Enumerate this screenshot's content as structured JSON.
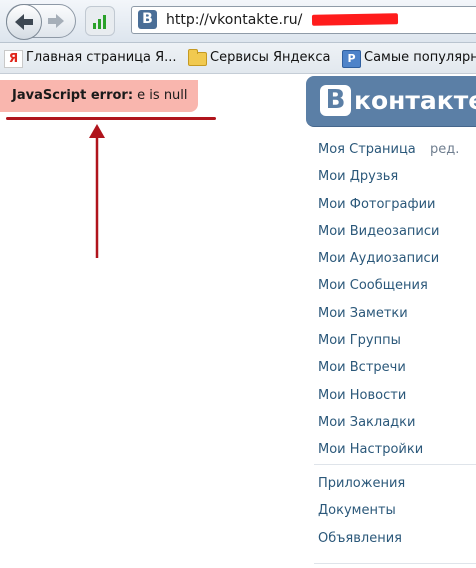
{
  "browser": {
    "url": "http://vkontakte.ru/",
    "bookmarks": [
      {
        "icon": "yandex-icon",
        "label": "Главная страница Я..."
      },
      {
        "icon": "folder-icon",
        "label": "Сервисы Яндекса"
      },
      {
        "icon": "popular-icon",
        "label": "Самые популярн"
      }
    ]
  },
  "error": {
    "prefix": "JavaScript error:",
    "message": "e is null"
  },
  "vk": {
    "logo_letter": "В",
    "logo_text": "контакте",
    "edit_label": "ред.",
    "menu": [
      "Моя Страница",
      "Мои Друзья",
      "Мои Фотографии",
      "Мои Видеозаписи",
      "Мои Аудиозаписи",
      "Мои Сообщения",
      "Мои Заметки",
      "Мои Группы",
      "Мои Встречи",
      "Мои Новости",
      "Мои Закладки",
      "Мои Настройки"
    ],
    "extra_menu": [
      "Приложения",
      "Документы",
      "Объявления"
    ]
  },
  "colors": {
    "error_bg": "#f9b6ae",
    "annotation_red": "#b0141c",
    "vk_blue": "#5b7fa6",
    "link_blue": "#2b587a",
    "redaction": "#ff1c1c"
  }
}
